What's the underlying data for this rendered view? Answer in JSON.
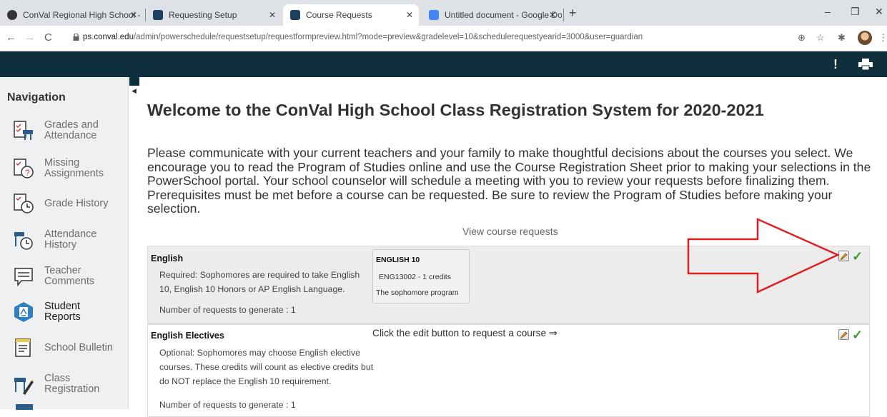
{
  "browser": {
    "tabs": [
      {
        "title": "ConVal Regional High School - R"
      },
      {
        "title": "Requesting Setup"
      },
      {
        "title": "Course Requests"
      },
      {
        "title": "Untitled document - Google Doc"
      }
    ],
    "url_host": "ps.conval.edu",
    "url_path": "/admin/powerschedule/requestsetup/requestformpreview.html?mode=preview&gradelevel=10&schedulerequestyearid=3000&user=guardian"
  },
  "sidebar": {
    "title": "Navigation",
    "items": [
      {
        "label": "Grades and Attendance",
        "icon": "grades-attendance-icon"
      },
      {
        "label": "Missing Assignments",
        "icon": "missing-assignments-icon"
      },
      {
        "label": "Grade History",
        "icon": "grade-history-icon"
      },
      {
        "label": "Attendance History",
        "icon": "attendance-history-icon"
      },
      {
        "label": "Teacher Comments",
        "icon": "teacher-comments-icon"
      },
      {
        "label": "Student Reports",
        "icon": "student-reports-icon"
      },
      {
        "label": "School Bulletin",
        "icon": "school-bulletin-icon"
      },
      {
        "label": "Class Registration",
        "icon": "class-registration-icon"
      }
    ]
  },
  "main": {
    "title": "Welcome to the ConVal High School Class Registration System for 2020-2021",
    "intro": "Please communicate with your current teachers and your family to make thoughtful decisions about the courses you select. We encourage you to read the Program of Studies online and use the Course Registration Sheet prior to making your selections in the PowerSchool portal. Your school counselor will schedule a meeting with you to review your requests before finalizing them. Prerequisites must be met before a course can be requested. Be sure to review the Program of Studies before making your selection.",
    "view_requests": "View course requests",
    "requests": [
      {
        "title": "English",
        "description": "Required: Sophomores are required to take English 10, English 10 Honors or AP English Language.",
        "count": "Number of requests to generate : 1",
        "course": {
          "name": "ENGLISH 10",
          "code": "ENG13002 - 1 credits",
          "desc": "The sophomore program"
        }
      },
      {
        "title": "English Electives",
        "description": "Optional: Sophomores may choose English elective courses. These credits will count as elective credits but do NOT replace the English 10 requirement.",
        "count": "Number of requests to generate : 1",
        "hint": "Click the edit button to request a course ⇒"
      }
    ]
  },
  "colors": {
    "header": "#0f2f3d",
    "check": "#3a9b2b",
    "annotation_arrow": "#e02020"
  }
}
